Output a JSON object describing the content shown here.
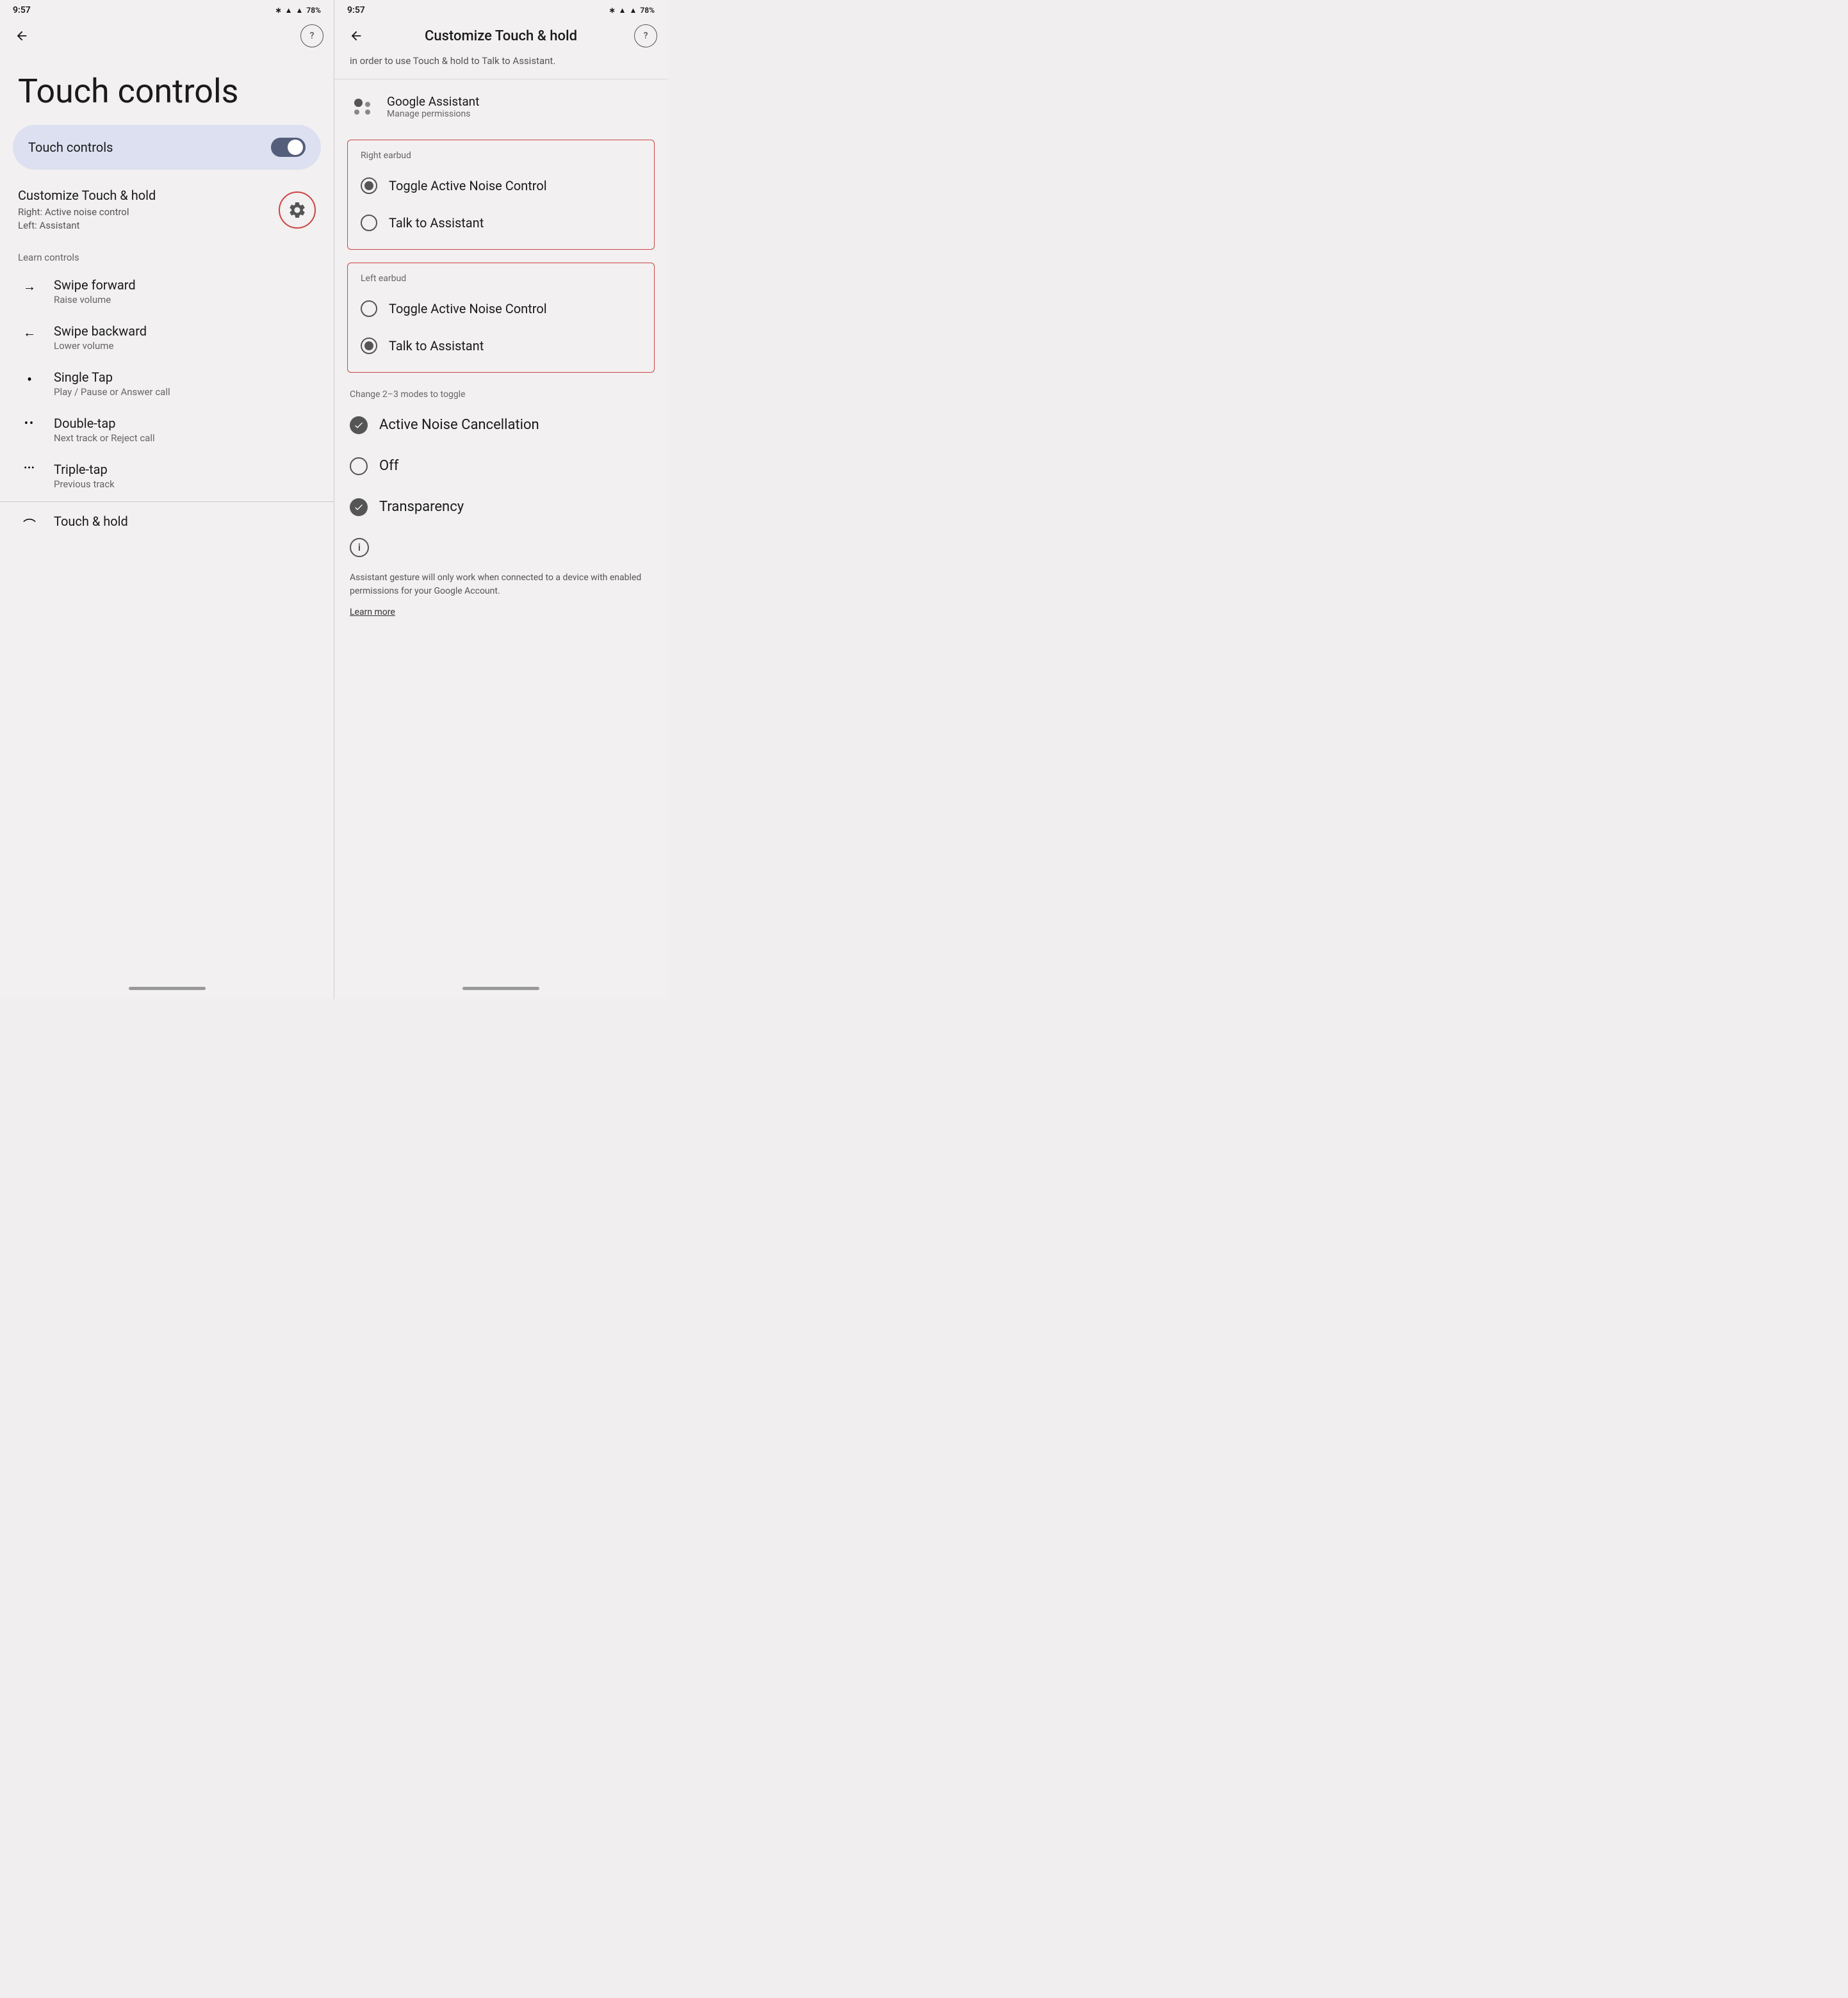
{
  "left": {
    "statusBar": {
      "time": "9:57",
      "battery": "78%"
    },
    "backLabel": "←",
    "helpLabel": "?",
    "pageTitle": "Touch controls",
    "toggleSection": {
      "label": "Touch controls",
      "toggleOn": true
    },
    "customizeSection": {
      "title": "Customize Touch & hold",
      "subtitle1": "Right: Active noise control",
      "subtitle2": "Left: Assistant"
    },
    "learnControlsLabel": "Learn controls",
    "gestures": [
      {
        "icon": "→",
        "title": "Swipe forward",
        "sub": "Raise volume"
      },
      {
        "icon": "←",
        "title": "Swipe backward",
        "sub": "Lower volume"
      },
      {
        "icon": "•",
        "title": "Single Tap",
        "sub": "Play / Pause or Answer call"
      },
      {
        "icon": "••",
        "title": "Double-tap",
        "sub": "Next track or Reject call"
      },
      {
        "icon": "•••",
        "title": "Triple-tap",
        "sub": "Previous track"
      },
      {
        "icon": "⌒",
        "title": "Touch & hold",
        "sub": ""
      }
    ]
  },
  "right": {
    "statusBar": {
      "time": "9:57",
      "battery": "78%"
    },
    "backLabel": "←",
    "helpLabel": "?",
    "topTitle": "Customize Touch & hold",
    "scrollHintText": "in order to use Touch & hold to Talk to Assistant.",
    "assistantTitle": "Google Assistant",
    "assistantSub": "Manage permissions",
    "rightEarbud": {
      "label": "Right earbud",
      "options": [
        {
          "label": "Toggle Active Noise Control",
          "selected": true
        },
        {
          "label": "Talk to Assistant",
          "selected": false
        }
      ]
    },
    "leftEarbud": {
      "label": "Left earbud",
      "options": [
        {
          "label": "Toggle Active Noise Control",
          "selected": false
        },
        {
          "label": "Talk to Assistant",
          "selected": true
        }
      ]
    },
    "modesLabel": "Change 2–3 modes to toggle",
    "modes": [
      {
        "label": "Active Noise Cancellation",
        "checked": true
      },
      {
        "label": "Off",
        "checked": false
      },
      {
        "label": "Transparency",
        "checked": true
      }
    ],
    "footerText": "Assistant gesture will only work when connected to a device with enabled permissions for your Google Account.",
    "learnMoreLabel": "Learn more"
  }
}
